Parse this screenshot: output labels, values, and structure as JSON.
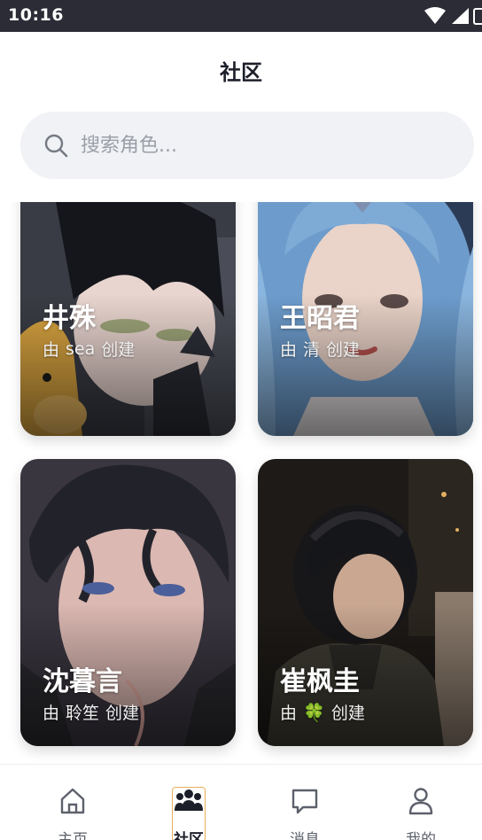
{
  "status_bar": {
    "time": "10:16",
    "icons": [
      "wifi-icon",
      "signal-icon",
      "battery-icon"
    ]
  },
  "header": {
    "title": "社区"
  },
  "search": {
    "placeholder": "搜索角色...",
    "value": ""
  },
  "cards": [
    {
      "name": "井殊",
      "creator_prefix": "由",
      "creator": "sea",
      "creator_suffix": "创建"
    },
    {
      "name": "王昭君",
      "creator_prefix": "由",
      "creator": "清",
      "creator_suffix": "创建"
    },
    {
      "name": "沈暮言",
      "creator_prefix": "由",
      "creator": "聆笙",
      "creator_suffix": "创建"
    },
    {
      "name": "崔枫圭",
      "creator_prefix": "由",
      "creator": "🍀",
      "creator_suffix": "创建",
      "creator_icon": "clover-icon"
    }
  ],
  "bottom_nav": {
    "items": [
      {
        "label": "主页",
        "icon": "home-icon"
      },
      {
        "label": "社区",
        "icon": "community-icon",
        "active": true
      },
      {
        "label": "消息",
        "icon": "message-icon"
      },
      {
        "label": "我的",
        "icon": "user-icon"
      }
    ]
  },
  "colors": {
    "status_bar": "#2b2c36",
    "search_bg": "#f1f2f5",
    "active_outline": "#e8b05a",
    "title": "#1c1f2a"
  }
}
